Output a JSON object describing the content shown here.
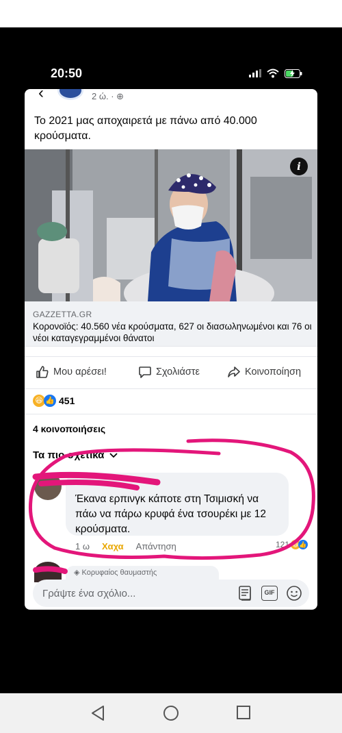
{
  "status_bar": {
    "time": "20:50"
  },
  "post": {
    "time_ago": "2 ώ. ·",
    "text": "Το 2021 μας αποχαιρετά με πάνω από 40.000 κρούσματα.",
    "link": {
      "domain": "GAZZETTA.GR",
      "title": "Κορονοϊός: 40.560 νέα κρούσματα, 627 οι διασωληνωμένοι και 76 οι νέοι καταγεγραμμένοι θάνατοι"
    },
    "actions": {
      "like": "Μου αρέσει!",
      "comment": "Σχολιάστε",
      "share": "Κοινοποίηση"
    },
    "reactions_count": "451",
    "shares": "4 κοινοποιήσεις",
    "sort_label": "Τα πιο σχετικά"
  },
  "comments": [
    {
      "text": "Έκανα ερπινγκ κάποτε στη Τσιμισκή να πάω να πάρω κρυφά ένα τσουρέκι με 12 κρούσματα.",
      "time": "1 ω",
      "reaction_label": "Χαχα",
      "reply_label": "Απάντηση",
      "reaction_count": "121"
    },
    {
      "badge": "Κορυφαίος θαυμαστής"
    }
  ],
  "composer": {
    "placeholder": "Γράψτε ένα σχόλιο..."
  },
  "colors": {
    "accent": "#1877f2",
    "annotation": "#e3167a",
    "haha": "#e8a600"
  }
}
